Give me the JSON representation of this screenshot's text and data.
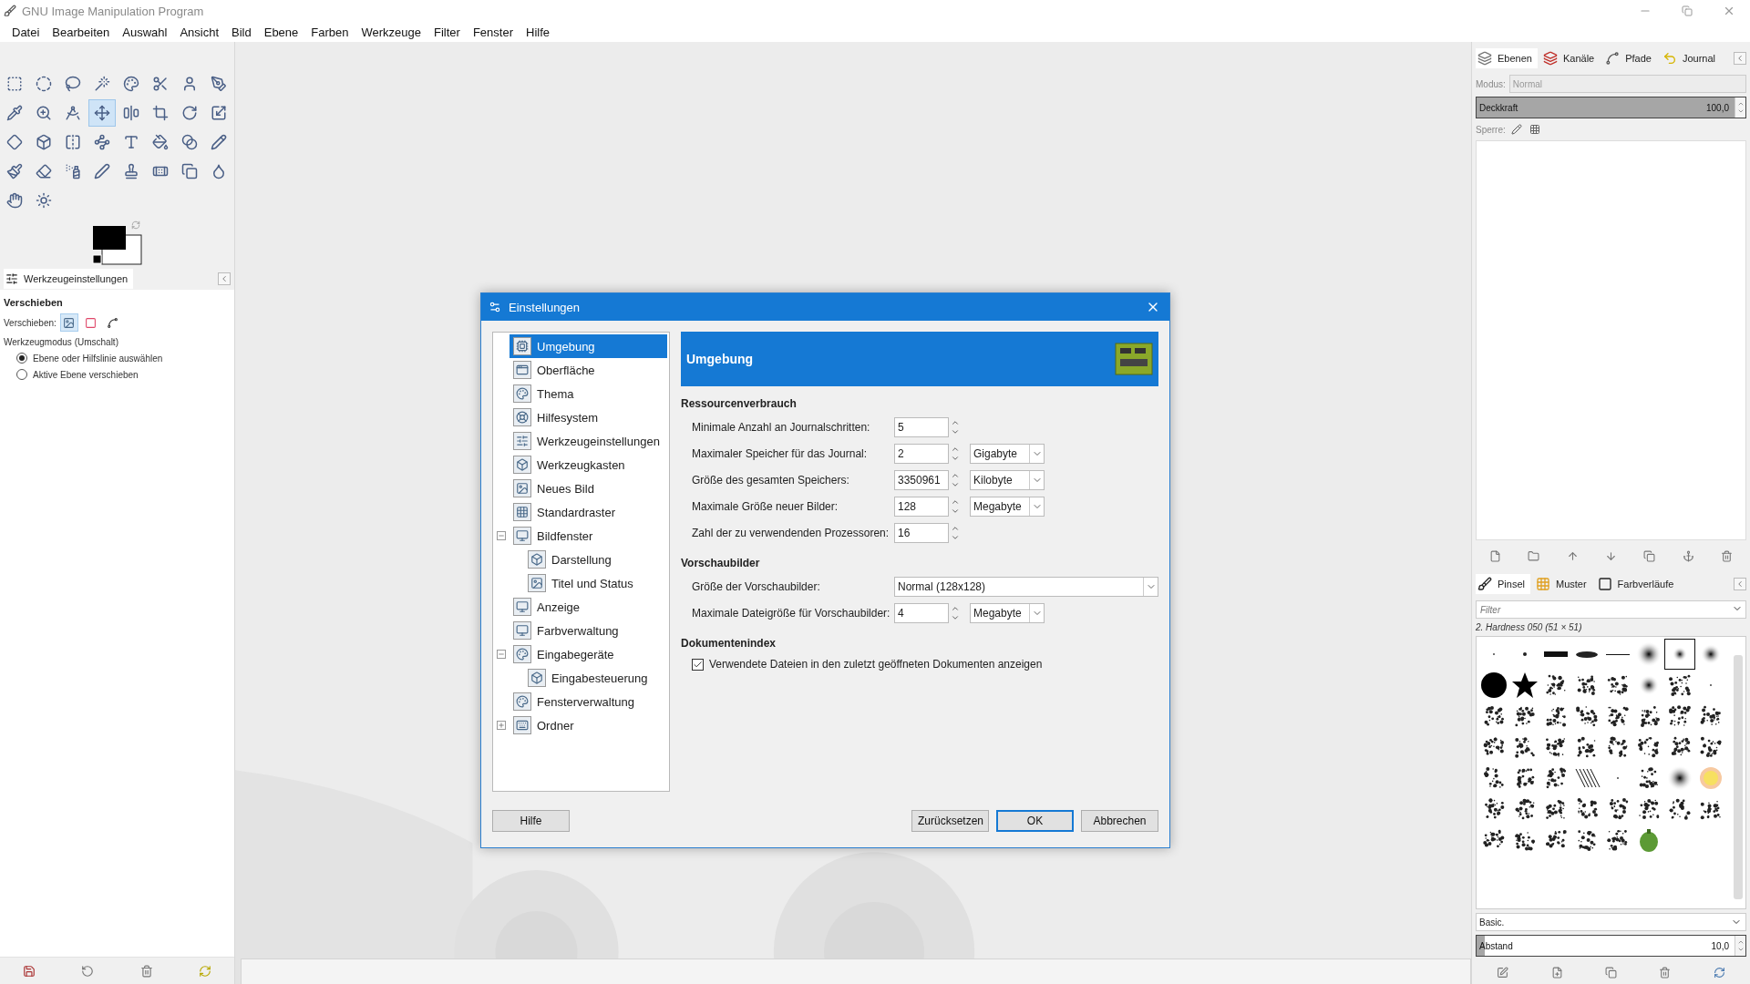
{
  "window": {
    "title": "GNU Image Manipulation Program"
  },
  "menu": [
    "Datei",
    "Bearbeiten",
    "Auswahl",
    "Ansicht",
    "Bild",
    "Ebene",
    "Farben",
    "Werkzeuge",
    "Filter",
    "Fenster",
    "Hilfe"
  ],
  "toolbox": {
    "tools": [
      {
        "kind": "rect-select",
        "selected": false
      },
      {
        "kind": "ellipse-select",
        "selected": false
      },
      {
        "kind": "free-select",
        "selected": false
      },
      {
        "kind": "fuzzy-select",
        "selected": false
      },
      {
        "kind": "color-select",
        "selected": false
      },
      {
        "kind": "scissors",
        "selected": false
      },
      {
        "kind": "foreground-select",
        "selected": false
      },
      {
        "kind": "paths",
        "selected": false
      },
      {
        "kind": "color-picker",
        "selected": false
      },
      {
        "kind": "zoom",
        "selected": false
      },
      {
        "kind": "measure",
        "selected": false
      },
      {
        "kind": "move",
        "selected": true
      },
      {
        "kind": "align",
        "selected": false
      },
      {
        "kind": "crop",
        "selected": false
      },
      {
        "kind": "rotate",
        "selected": false
      },
      {
        "kind": "scale",
        "selected": false
      },
      {
        "kind": "shear",
        "selected": false
      },
      {
        "kind": "perspective",
        "selected": false
      },
      {
        "kind": "flip",
        "selected": false
      },
      {
        "kind": "cage",
        "selected": false
      },
      {
        "kind": "text",
        "selected": false
      },
      {
        "kind": "bucket",
        "selected": false
      },
      {
        "kind": "blend",
        "selected": false
      },
      {
        "kind": "pencil",
        "selected": false
      },
      {
        "kind": "paintbrush",
        "selected": false
      },
      {
        "kind": "eraser",
        "selected": false
      },
      {
        "kind": "airbrush",
        "selected": false
      },
      {
        "kind": "ink",
        "selected": false
      },
      {
        "kind": "clone",
        "selected": false
      },
      {
        "kind": "heal",
        "selected": false
      },
      {
        "kind": "perspective-clone",
        "selected": false
      },
      {
        "kind": "blur",
        "selected": false
      },
      {
        "kind": "smudge",
        "selected": false
      },
      {
        "kind": "dodge",
        "selected": false
      }
    ]
  },
  "tool_options": {
    "tab": "Werkzeugeinstellungen",
    "heading": "Verschieben",
    "move_label": "Verschieben:",
    "move_targets": [
      {
        "kind": "layer",
        "selected": true
      },
      {
        "kind": "selection",
        "selected": false
      },
      {
        "kind": "path",
        "selected": false
      }
    ],
    "mode_label": "Werkzeugmodus (Umschalt)",
    "modes": [
      {
        "label": "Ebene oder Hilfslinie auswählen",
        "selected": true
      },
      {
        "label": "Aktive Ebene verschieben",
        "selected": false
      }
    ]
  },
  "dialog": {
    "title": "Einstellungen",
    "tree": [
      {
        "label": "Umgebung",
        "selected": true
      },
      {
        "label": "Oberfläche",
        "selected": false
      },
      {
        "label": "Thema",
        "selected": false
      },
      {
        "label": "Hilfesystem",
        "selected": false
      },
      {
        "label": "Werkzeugeinstellungen",
        "selected": false
      },
      {
        "label": "Werkzeugkasten",
        "selected": false
      },
      {
        "label": "Neues Bild",
        "selected": false
      },
      {
        "label": "Standardraster",
        "selected": false
      },
      {
        "label": "Bildfenster",
        "selected": false,
        "expanded": true,
        "children": [
          {
            "label": "Darstellung",
            "selected": false
          },
          {
            "label": "Titel und Status",
            "selected": false
          }
        ]
      },
      {
        "label": "Anzeige",
        "selected": false
      },
      {
        "label": "Farbverwaltung",
        "selected": false
      },
      {
        "label": "Eingabegeräte",
        "selected": false,
        "expanded": true,
        "children": [
          {
            "label": "Eingabesteuerung",
            "selected": false
          }
        ]
      },
      {
        "label": "Fensterverwaltung",
        "selected": false
      },
      {
        "label": "Ordner",
        "selected": false,
        "expanded": false
      }
    ],
    "header": "Umgebung",
    "sections": [
      {
        "title": "Ressourcenverbrauch",
        "fields": [
          {
            "kind": "spin",
            "label": "Minimale Anzahl an Journalschritten:",
            "value": "5"
          },
          {
            "kind": "spin",
            "label": "Maximaler Speicher für das Journal:",
            "value": "2",
            "unit": "Gigabyte"
          },
          {
            "kind": "spin",
            "label": "Größe des gesamten Speichers:",
            "value": "3350961",
            "unit": "Kilobyte"
          },
          {
            "kind": "spin",
            "label": "Maximale Größe neuer Bilder:",
            "value": "128",
            "unit": "Megabyte"
          },
          {
            "kind": "spin",
            "label": "Zahl der zu verwendenden Prozessoren:",
            "value": "16"
          }
        ]
      },
      {
        "title": "Vorschaubilder",
        "fields": [
          {
            "kind": "select",
            "label": "Größe der Vorschaubilder:",
            "value": "Normal (128x128)"
          },
          {
            "kind": "spin",
            "label": "Maximale Dateigröße für Vorschaubilder:",
            "value": "4",
            "unit": "Megabyte"
          }
        ]
      },
      {
        "title": "Dokumentenindex",
        "fields": [
          {
            "kind": "checkbox",
            "label": "Verwendete Dateien in den zuletzt geöffneten Dokumenten anzeigen",
            "checked": true
          }
        ]
      }
    ],
    "buttons": [
      {
        "label": "Hilfe",
        "default": false
      },
      {
        "label": "Zurücksetzen",
        "default": false
      },
      {
        "label": "OK",
        "default": true
      },
      {
        "label": "Abbrechen",
        "default": false
      }
    ]
  },
  "layers_dock": {
    "tabs": [
      {
        "label": "Ebenen",
        "selected": true
      },
      {
        "label": "Kanäle",
        "selected": false
      },
      {
        "label": "Pfade",
        "selected": false
      },
      {
        "label": "Journal",
        "selected": false
      }
    ],
    "mode_label": "Modus:",
    "mode_value": "Normal",
    "mode_disabled": true,
    "opacity": {
      "label": "Deckkraft",
      "value": "100,0",
      "level": 1
    },
    "lock_label": "Sperre:"
  },
  "brushes_dock": {
    "tabs": [
      {
        "label": "Pinsel",
        "selected": true
      },
      {
        "label": "Muster",
        "selected": false
      },
      {
        "label": "Farbverläufe",
        "selected": false
      }
    ],
    "filter_placeholder": "Filter",
    "brush_name": "2. Hardness 050 (51 × 51)",
    "brushes": [
      {
        "kind": "tiny",
        "selected": false
      },
      {
        "kind": "dot",
        "selected": false
      },
      {
        "kind": "bar",
        "selected": false
      },
      {
        "kind": "ellipse",
        "selected": false
      },
      {
        "kind": "line",
        "selected": false
      },
      {
        "kind": "soft",
        "selected": false
      },
      {
        "kind": "soft",
        "selected": true
      },
      {
        "kind": "soft",
        "selected": false
      },
      {
        "kind": "disc",
        "selected": false
      },
      {
        "kind": "star",
        "selected": false
      },
      {
        "kind": "speckle",
        "selected": false
      },
      {
        "kind": "speckle",
        "selected": false
      },
      {
        "kind": "speckle",
        "selected": false
      },
      {
        "kind": "soft",
        "selected": false
      },
      {
        "kind": "speckle",
        "selected": false
      },
      {
        "kind": "tiny",
        "selected": false
      },
      {
        "kind": "speckle",
        "selected": false
      },
      {
        "kind": "speckle",
        "selected": false
      },
      {
        "kind": "speckle",
        "selected": false
      },
      {
        "kind": "speckle",
        "selected": false
      },
      {
        "kind": "speckle",
        "selected": false
      },
      {
        "kind": "speckle",
        "selected": false
      },
      {
        "kind": "speckle",
        "selected": false
      },
      {
        "kind": "speckle",
        "selected": false
      },
      {
        "kind": "speckle",
        "selected": false
      },
      {
        "kind": "speckle",
        "selected": false
      },
      {
        "kind": "speckle",
        "selected": false
      },
      {
        "kind": "speckle",
        "selected": false
      },
      {
        "kind": "speckle",
        "selected": false
      },
      {
        "kind": "speckle",
        "selected": false
      },
      {
        "kind": "speckle",
        "selected": false
      },
      {
        "kind": "speckle",
        "selected": false
      },
      {
        "kind": "speckle",
        "selected": false
      },
      {
        "kind": "speckle",
        "selected": false
      },
      {
        "kind": "speckle",
        "selected": false
      },
      {
        "kind": "lines",
        "selected": false
      },
      {
        "kind": "tiny",
        "selected": false
      },
      {
        "kind": "speckle",
        "selected": false
      },
      {
        "kind": "soft",
        "selected": false
      },
      {
        "kind": "glow",
        "selected": false
      },
      {
        "kind": "speckle",
        "selected": false
      },
      {
        "kind": "speckle",
        "selected": false
      },
      {
        "kind": "speckle",
        "selected": false
      },
      {
        "kind": "speckle",
        "selected": false
      },
      {
        "kind": "speckle",
        "selected": false
      },
      {
        "kind": "speckle",
        "selected": false
      },
      {
        "kind": "speckle",
        "selected": false
      },
      {
        "kind": "speckle",
        "selected": false
      },
      {
        "kind": "speckle",
        "selected": false
      },
      {
        "kind": "speckle",
        "selected": false
      },
      {
        "kind": "speckle",
        "selected": false
      },
      {
        "kind": "speckle",
        "selected": false
      },
      {
        "kind": "speckle",
        "selected": false
      },
      {
        "kind": "pepper",
        "selected": false
      }
    ],
    "preset": "Basic.",
    "spacing": {
      "label": "Abstand",
      "value": "10,0",
      "level": 0.03
    }
  }
}
